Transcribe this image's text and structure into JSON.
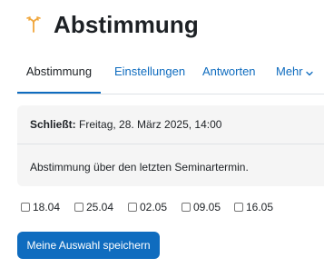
{
  "header": {
    "title": "Abstimmung",
    "icon": "choice-icon",
    "icon_color": "#f0a63b"
  },
  "tabs": [
    {
      "label": "Abstimmung",
      "active": true
    },
    {
      "label": "Einstellungen",
      "active": false
    },
    {
      "label": "Antworten",
      "active": false
    },
    {
      "label": "Mehr",
      "active": false
    }
  ],
  "dates": {
    "closes_label": "Schließt:",
    "closes_value": "Freitag, 28. März 2025, 14:00"
  },
  "intro": "Abstimmung über den letzten Seminartermin.",
  "options": [
    {
      "label": "18.04",
      "checked": false
    },
    {
      "label": "25.04",
      "checked": false
    },
    {
      "label": "02.05",
      "checked": false
    },
    {
      "label": "09.05",
      "checked": false
    },
    {
      "label": "16.05",
      "checked": false
    }
  ],
  "save_button": {
    "label": "Meine Auswahl speichern"
  },
  "colors": {
    "link": "#0f6cbf",
    "primary_button": "#0f6cbf",
    "panel_bg": "#f5f5f5"
  }
}
